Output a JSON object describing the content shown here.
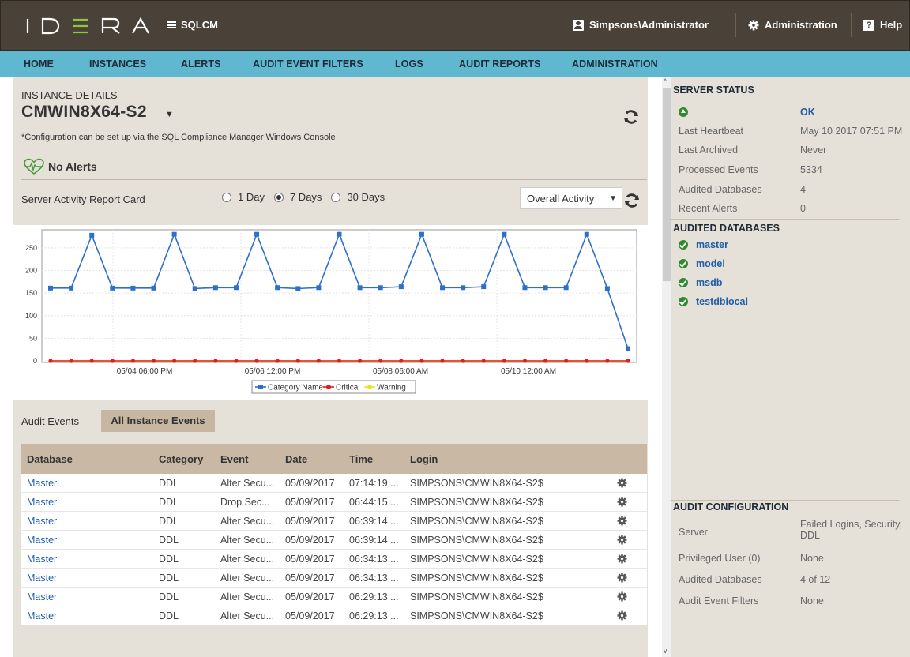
{
  "topbar": {
    "logo": "IDERA",
    "product": "SQLCM",
    "user": "Simpsons\\Administrator",
    "admin": "Administration",
    "help": "Help"
  },
  "nav": [
    "HOME",
    "INSTANCES",
    "ALERTS",
    "AUDIT EVENT FILTERS",
    "LOGS",
    "AUDIT REPORTS",
    "ADMINISTRATION"
  ],
  "instance": {
    "label": "INSTANCE DETAILS",
    "name": "CMWIN8X64-S2",
    "note": "*Configuration can be set up via the SQL Compliance Manager Windows Console",
    "alerts": "No Alerts"
  },
  "report": {
    "title": "Server Activity Report Card",
    "ranges": [
      "1 Day",
      "7 Days",
      "30 Days"
    ],
    "selected_range": "7 Days",
    "activity_select": "Overall Activity"
  },
  "chart_data": {
    "type": "line",
    "x_tick_labels": [
      "05/04 06:00 PM",
      "05/06 12:00 PM",
      "05/08 06:00 AM",
      "05/10 12:00 AM"
    ],
    "y_ticks": [
      0,
      50,
      100,
      150,
      200,
      250
    ],
    "ylim": [
      0,
      290
    ],
    "series": [
      {
        "name": "Category Name",
        "color": "#2e6fc8",
        "values": [
          161,
          161,
          278,
          161,
          161,
          161,
          280,
          160,
          162,
          162,
          280,
          162,
          160,
          162,
          280,
          162,
          162,
          164,
          280,
          162,
          162,
          164,
          280,
          162,
          162,
          162,
          280,
          160,
          27
        ]
      },
      {
        "name": "Critical",
        "color": "#e0201c",
        "values": [
          0,
          0,
          0,
          0,
          0,
          0,
          0,
          0,
          0,
          0,
          0,
          0,
          0,
          0,
          0,
          0,
          0,
          0,
          0,
          0,
          0,
          0,
          0,
          0,
          0,
          0,
          0,
          0,
          0
        ]
      },
      {
        "name": "Warning",
        "color": "#f0e020",
        "values": [
          0,
          0,
          0,
          0,
          0,
          0,
          0,
          0,
          0,
          0,
          0,
          0,
          0,
          0,
          0,
          0,
          0,
          0,
          0,
          0,
          0,
          0,
          0,
          0,
          0,
          0,
          0,
          0,
          0
        ]
      }
    ]
  },
  "tabs": {
    "audit": "Audit Events",
    "all": "All Instance Events"
  },
  "table": {
    "headers": [
      "Database",
      "Category",
      "Event",
      "Date",
      "Time",
      "Login"
    ],
    "rows": [
      [
        "Master",
        "DDL",
        "Alter Secu...",
        "05/09/2017",
        "07:14:19 ...",
        "SIMPSONS\\CMWIN8X64-S2$"
      ],
      [
        "Master",
        "DDL",
        "Drop Sec...",
        "05/09/2017",
        "06:44:15 ...",
        "SIMPSONS\\CMWIN8X64-S2$"
      ],
      [
        "Master",
        "DDL",
        "Alter Secu...",
        "05/09/2017",
        "06:39:14 ...",
        "SIMPSONS\\CMWIN8X64-S2$"
      ],
      [
        "Master",
        "DDL",
        "Alter Secu...",
        "05/09/2017",
        "06:39:14 ...",
        "SIMPSONS\\CMWIN8X64-S2$"
      ],
      [
        "Master",
        "DDL",
        "Alter Secu...",
        "05/09/2017",
        "06:34:13 ...",
        "SIMPSONS\\CMWIN8X64-S2$"
      ],
      [
        "Master",
        "DDL",
        "Alter Secu...",
        "05/09/2017",
        "06:34:13 ...",
        "SIMPSONS\\CMWIN8X64-S2$"
      ],
      [
        "Master",
        "DDL",
        "Alter Secu...",
        "05/09/2017",
        "06:29:13 ...",
        "SIMPSONS\\CMWIN8X64-S2$"
      ],
      [
        "Master",
        "DDL",
        "Alter Secu...",
        "05/09/2017",
        "06:29:13 ...",
        "SIMPSONS\\CMWIN8X64-S2$"
      ]
    ]
  },
  "server_status": {
    "title": "SERVER STATUS",
    "status": "OK",
    "items": [
      {
        "label": "Last Heartbeat",
        "value": "May 10 2017 07:51 PM"
      },
      {
        "label": "Last Archived",
        "value": "Never"
      },
      {
        "label": "Processed Events",
        "value": "5334"
      },
      {
        "label": "Audited Databases",
        "value": "4"
      },
      {
        "label": "Recent Alerts",
        "value": "0"
      }
    ]
  },
  "audited_databases": {
    "title": "AUDITED DATABASES",
    "items": [
      "master",
      "model",
      "msdb",
      "testdblocal"
    ]
  },
  "audit_config": {
    "title": "AUDIT CONFIGURATION",
    "items": [
      {
        "label": "Server",
        "value": "Failed Logins, Security, DDL"
      },
      {
        "label": "Privileged User (0)",
        "value": "None"
      },
      {
        "label": "Audited Databases",
        "value": "4 of 12"
      },
      {
        "label": "Audit Event Filters",
        "value": "None"
      }
    ]
  }
}
